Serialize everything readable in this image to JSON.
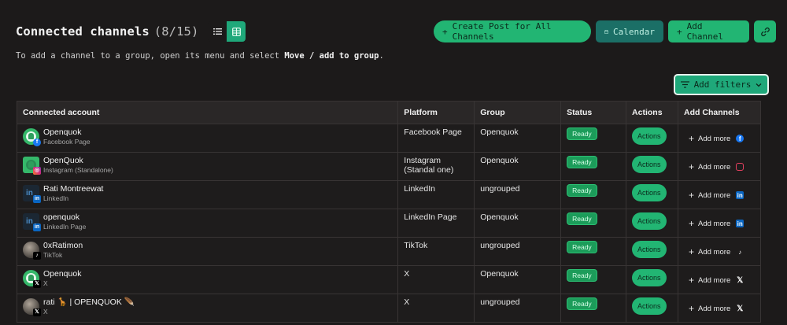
{
  "header": {
    "title": "Connected channels",
    "count": "(8/15)",
    "create_post_label": "Create Post for All Channels",
    "calendar_label": "Calendar",
    "add_channel_label": "Add Channel"
  },
  "hint": {
    "prefix": "To add a channel to a group, open its menu and select ",
    "action": "Move / add to group",
    "suffix": "."
  },
  "filters": {
    "label": "Add filters"
  },
  "table": {
    "columns": [
      "Connected account",
      "Platform",
      "Group",
      "Status",
      "Actions",
      "Add Channels"
    ],
    "rows": [
      {
        "name": "Openquok",
        "sub": "Facebook Page",
        "platform": "Facebook Page",
        "group": "Openquok",
        "status": "Ready",
        "actions": "Actions",
        "add": "Add more",
        "icon": "facebook-icon"
      },
      {
        "name": "OpenQuok",
        "sub": "Instagram (Standalone)",
        "platform": "Instagram (Standal one)",
        "group": "Openquok",
        "status": "Ready",
        "actions": "Actions",
        "add": "Add more",
        "icon": "instagram-icon"
      },
      {
        "name": "Rati Montreewat",
        "sub": "LinkedIn",
        "platform": "LinkedIn",
        "group": "ungrouped",
        "status": "Ready",
        "actions": "Actions",
        "add": "Add more",
        "icon": "linkedin-icon"
      },
      {
        "name": "openquok",
        "sub": "LinkedIn Page",
        "platform": "LinkedIn Page",
        "group": "Openquok",
        "status": "Ready",
        "actions": "Actions",
        "add": "Add more",
        "icon": "linkedin-icon"
      },
      {
        "name": "0xRatimon",
        "sub": "TikTok",
        "platform": "TikTok",
        "group": "ungrouped",
        "status": "Ready",
        "actions": "Actions",
        "add": "Add more",
        "icon": "tiktok-icon"
      },
      {
        "name": "Openquok",
        "sub": "X",
        "platform": "X",
        "group": "Openquok",
        "status": "Ready",
        "actions": "Actions",
        "add": "Add more",
        "icon": "x-icon"
      },
      {
        "name": "rati 🦒 | OPENQUOK 🪶",
        "sub": "X",
        "platform": "X",
        "group": "ungrouped",
        "status": "Ready",
        "actions": "Actions",
        "add": "Add more",
        "icon": "x-icon"
      }
    ]
  },
  "colors": {
    "accent": "#22b573",
    "background": "#1c1a1a",
    "calendar": "#1b6f66"
  }
}
